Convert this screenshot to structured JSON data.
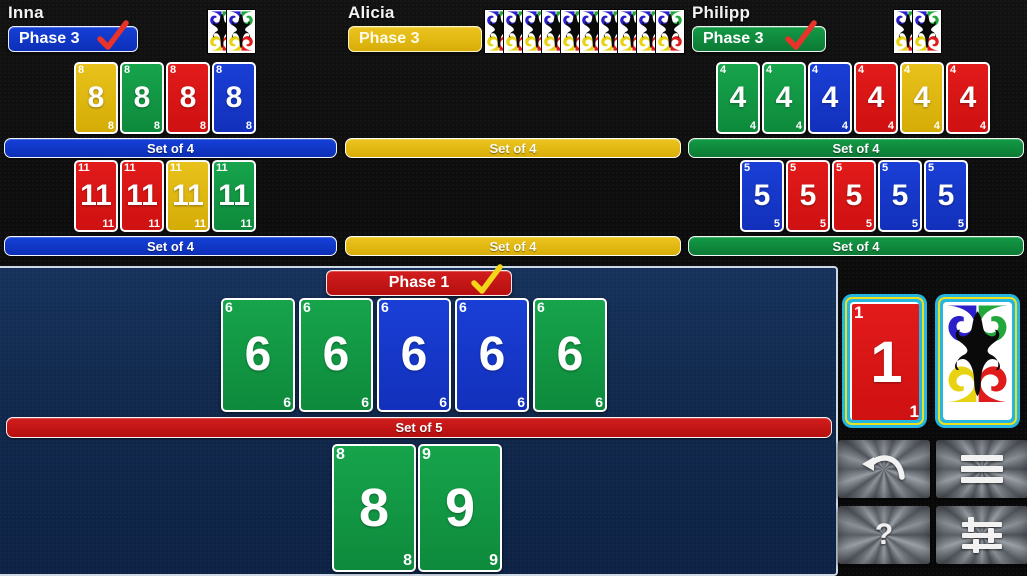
{
  "players": [
    {
      "name": "Inna",
      "phase_label": "Phase 3",
      "phase_color": "blue",
      "completed": true,
      "hand_count": 2,
      "sets": [
        {
          "bar_label": "Set of 4",
          "bar_color": "blue",
          "cards": [
            {
              "value": "8",
              "color": "yellow"
            },
            {
              "value": "8",
              "color": "green"
            },
            {
              "value": "8",
              "color": "red"
            },
            {
              "value": "8",
              "color": "blue"
            }
          ]
        },
        {
          "bar_label": "Set of 4",
          "bar_color": "blue",
          "cards": [
            {
              "value": "11",
              "color": "red"
            },
            {
              "value": "11",
              "color": "red"
            },
            {
              "value": "11",
              "color": "yellow"
            },
            {
              "value": "11",
              "color": "green"
            }
          ]
        }
      ]
    },
    {
      "name": "Alicia",
      "phase_label": "Phase 3",
      "phase_color": "yellow",
      "completed": false,
      "hand_count": 10,
      "sets": [
        {
          "bar_label": "Set of 4",
          "bar_color": "yellow",
          "cards": []
        },
        {
          "bar_label": "Set of 4",
          "bar_color": "yellow",
          "cards": []
        }
      ]
    },
    {
      "name": "Philipp",
      "phase_label": "Phase 3",
      "phase_color": "green",
      "completed": true,
      "hand_count": 2,
      "sets": [
        {
          "bar_label": "Set of 4",
          "bar_color": "green",
          "cards": [
            {
              "value": "4",
              "color": "green"
            },
            {
              "value": "4",
              "color": "green"
            },
            {
              "value": "4",
              "color": "blue"
            },
            {
              "value": "4",
              "color": "red"
            },
            {
              "value": "4",
              "color": "yellow"
            },
            {
              "value": "4",
              "color": "red"
            }
          ]
        },
        {
          "bar_label": "Set of 4",
          "bar_color": "green",
          "cards": [
            {
              "value": "5",
              "color": "blue"
            },
            {
              "value": "5",
              "color": "red"
            },
            {
              "value": "5",
              "color": "red"
            },
            {
              "value": "5",
              "color": "blue"
            },
            {
              "value": "5",
              "color": "blue"
            }
          ]
        }
      ]
    }
  ],
  "local_player": {
    "phase_label": "Phase 1",
    "phase_color": "red",
    "completed": true,
    "set_bar_label": "Set of 5",
    "set_bar_color": "red",
    "table_cards": [
      {
        "value": "6",
        "color": "green"
      },
      {
        "value": "6",
        "color": "green"
      },
      {
        "value": "6",
        "color": "blue"
      },
      {
        "value": "6",
        "color": "blue"
      },
      {
        "value": "6",
        "color": "green"
      }
    ],
    "hand_cards": [
      {
        "value": "8",
        "color": "green"
      },
      {
        "value": "9",
        "color": "green"
      }
    ]
  },
  "piles": {
    "discard": {
      "value": "1",
      "color": "red",
      "name": "discard-pile"
    },
    "draw": {
      "face": "card-back",
      "name": "draw-pile"
    }
  },
  "buttons": [
    {
      "id": "undo",
      "icon": "undo-arrow-icon",
      "label": ""
    },
    {
      "id": "menu",
      "icon": "hamburger-menu-icon",
      "label": ""
    },
    {
      "id": "help",
      "icon": "question-mark-icon",
      "label": "?"
    },
    {
      "id": "settings",
      "icon": "sliders-settings-icon",
      "label": ""
    }
  ],
  "colors": {
    "red": "#e21a1a",
    "blue": "#1a3fd6",
    "green": "#16a44b",
    "yellow": "#e8c21b",
    "table_bg": "#112a4e",
    "highlight": "#ece11f",
    "highlight2": "#27b6e0"
  }
}
